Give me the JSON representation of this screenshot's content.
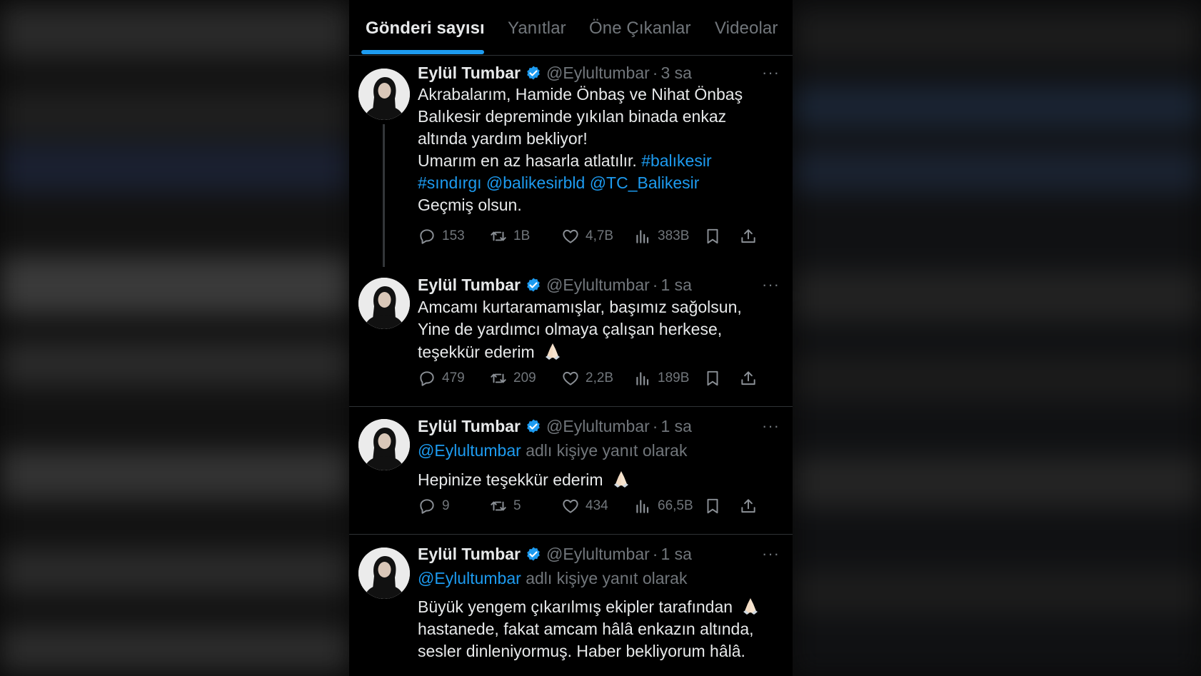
{
  "tabs": [
    "Gönderi sayısı",
    "Yanıtlar",
    "Öne Çıkanlar",
    "Videolar"
  ],
  "colors": {
    "accent": "#1d9bf0",
    "text": "#e7e9ea",
    "muted": "#71767b",
    "border": "#2f3336"
  },
  "icons": [
    "verified-badge-icon",
    "more-icon",
    "reply-icon",
    "retweet-icon",
    "like-icon",
    "views-icon",
    "bookmark-icon",
    "share-icon",
    "folded-hands-emoji"
  ],
  "tweets": [
    {
      "name": "Eylül Tumbar",
      "handle": "@Eylultumbar",
      "dot": "·",
      "time": "3 sa",
      "more": "···",
      "lines": [
        "Akrabalarım, Hamide Önbaş ve Nihat Önbaş",
        "Balıkesir depreminde yıkılan binada enkaz",
        "altında yardım bekliyor!",
        "Umarım en az hasarla atlatılır."
      ],
      "tag1": "#balıkesir",
      "tag2": "#sındırgı",
      "mention1": "@balikesirbld",
      "mention2": "@TC_Balikesir",
      "last_line": "Geçmiş olsun.",
      "stats": {
        "replies": "153",
        "retweets": "1B",
        "likes": "4,7B",
        "views": "383B"
      }
    },
    {
      "name": "Eylül Tumbar",
      "handle": "@Eylultumbar",
      "dot": "·",
      "time": "1 sa",
      "more": "···",
      "lines": [
        "Amcamı kurtaramamışlar, başımız sağolsun,",
        "Yine de yardımcı olmaya çalışan herkese,",
        "teşekkür ederim"
      ],
      "stats": {
        "replies": "479",
        "retweets": "209",
        "likes": "2,2B",
        "views": "189B"
      }
    },
    {
      "name": "Eylül Tumbar",
      "handle": "@Eylultumbar",
      "dot": "·",
      "time": "1 sa",
      "more": "···",
      "reply_mention": "@Eylultumbar",
      "reply_text": "adlı kişiye yanıt olarak",
      "text": "Hepinize teşekkür ederim",
      "stats": {
        "replies": "9",
        "retweets": "5",
        "likes": "434",
        "views": "66,5B"
      }
    },
    {
      "name": "Eylül Tumbar",
      "handle": "@Eylultumbar",
      "dot": "·",
      "time": "1 sa",
      "more": "···",
      "reply_mention": "@Eylultumbar",
      "reply_text": "adlı kişiye yanıt olarak",
      "lines": [
        "Büyük yengem çıkarılmış ekipler tarafından",
        "hastanede, fakat amcam hâlâ enkazın altında,",
        "sesler dinleniyormuş. Haber bekliyorum hâlâ."
      ]
    }
  ]
}
